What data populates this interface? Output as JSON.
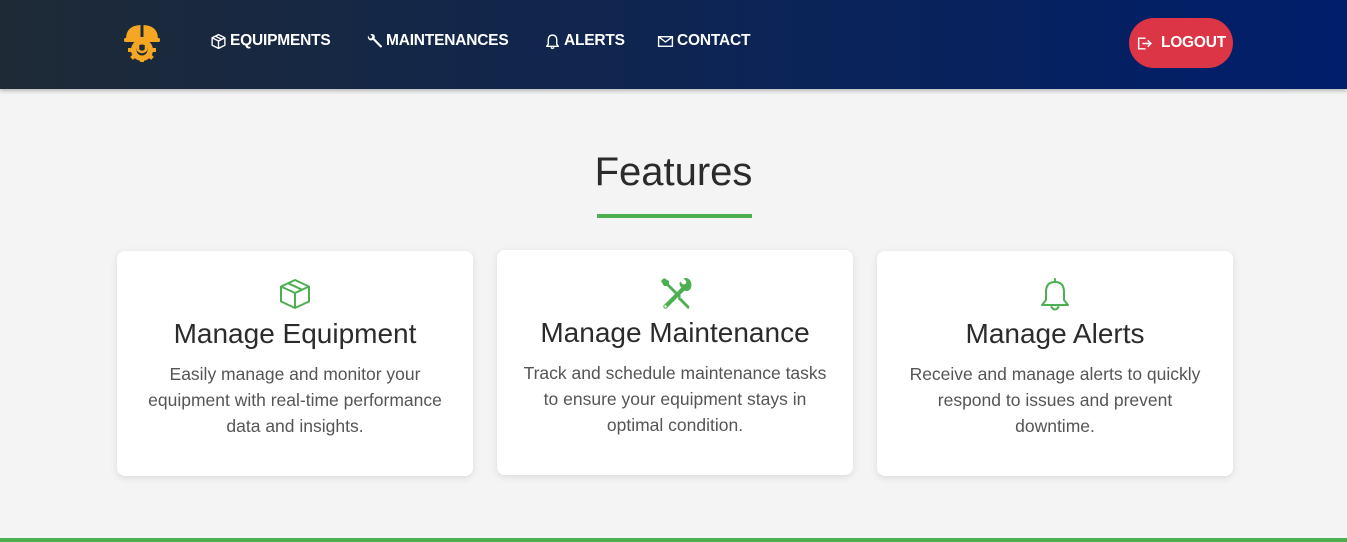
{
  "nav": {
    "items": [
      {
        "label": "EQUIPMENTS",
        "icon": "box-icon"
      },
      {
        "label": "MAINTENANCES",
        "icon": "wrench-icon"
      },
      {
        "label": "ALERTS",
        "icon": "bell-icon"
      },
      {
        "label": "CONTACT",
        "icon": "envelope-icon"
      }
    ],
    "logout_label": "LOGOUT"
  },
  "features": {
    "title": "Features",
    "cards": [
      {
        "title": "Manage Equipment",
        "description": "Easily manage and monitor your equipment with real-time performance data and insights.",
        "icon": "box-icon"
      },
      {
        "title": "Manage Maintenance",
        "description": "Track and schedule maintenance tasks to ensure your equipment stays in optimal condition.",
        "icon": "tools-icon"
      },
      {
        "title": "Manage Alerts",
        "description": "Receive and manage alerts to quickly respond to issues and prevent downtime.",
        "icon": "bell-icon"
      }
    ]
  },
  "colors": {
    "accent": "#4caf50",
    "logout": "#dc3545",
    "logo": "#f5a623",
    "nav_start": "#1e2a36",
    "nav_end": "#001e6b"
  }
}
